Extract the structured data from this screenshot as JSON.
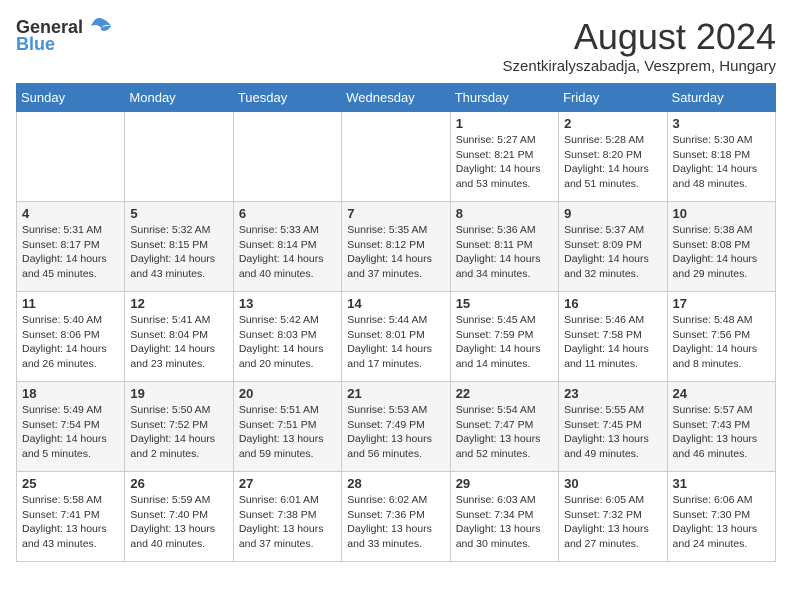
{
  "header": {
    "logo_general": "General",
    "logo_blue": "Blue",
    "month_year": "August 2024",
    "location": "Szentkiralyszabadja, Veszprem, Hungary"
  },
  "days_of_week": [
    "Sunday",
    "Monday",
    "Tuesday",
    "Wednesday",
    "Thursday",
    "Friday",
    "Saturday"
  ],
  "weeks": [
    {
      "days": [
        {
          "number": "",
          "info": ""
        },
        {
          "number": "",
          "info": ""
        },
        {
          "number": "",
          "info": ""
        },
        {
          "number": "",
          "info": ""
        },
        {
          "number": "1",
          "info": "Sunrise: 5:27 AM\nSunset: 8:21 PM\nDaylight: 14 hours and 53 minutes."
        },
        {
          "number": "2",
          "info": "Sunrise: 5:28 AM\nSunset: 8:20 PM\nDaylight: 14 hours and 51 minutes."
        },
        {
          "number": "3",
          "info": "Sunrise: 5:30 AM\nSunset: 8:18 PM\nDaylight: 14 hours and 48 minutes."
        }
      ]
    },
    {
      "days": [
        {
          "number": "4",
          "info": "Sunrise: 5:31 AM\nSunset: 8:17 PM\nDaylight: 14 hours and 45 minutes."
        },
        {
          "number": "5",
          "info": "Sunrise: 5:32 AM\nSunset: 8:15 PM\nDaylight: 14 hours and 43 minutes."
        },
        {
          "number": "6",
          "info": "Sunrise: 5:33 AM\nSunset: 8:14 PM\nDaylight: 14 hours and 40 minutes."
        },
        {
          "number": "7",
          "info": "Sunrise: 5:35 AM\nSunset: 8:12 PM\nDaylight: 14 hours and 37 minutes."
        },
        {
          "number": "8",
          "info": "Sunrise: 5:36 AM\nSunset: 8:11 PM\nDaylight: 14 hours and 34 minutes."
        },
        {
          "number": "9",
          "info": "Sunrise: 5:37 AM\nSunset: 8:09 PM\nDaylight: 14 hours and 32 minutes."
        },
        {
          "number": "10",
          "info": "Sunrise: 5:38 AM\nSunset: 8:08 PM\nDaylight: 14 hours and 29 minutes."
        }
      ]
    },
    {
      "days": [
        {
          "number": "11",
          "info": "Sunrise: 5:40 AM\nSunset: 8:06 PM\nDaylight: 14 hours and 26 minutes."
        },
        {
          "number": "12",
          "info": "Sunrise: 5:41 AM\nSunset: 8:04 PM\nDaylight: 14 hours and 23 minutes."
        },
        {
          "number": "13",
          "info": "Sunrise: 5:42 AM\nSunset: 8:03 PM\nDaylight: 14 hours and 20 minutes."
        },
        {
          "number": "14",
          "info": "Sunrise: 5:44 AM\nSunset: 8:01 PM\nDaylight: 14 hours and 17 minutes."
        },
        {
          "number": "15",
          "info": "Sunrise: 5:45 AM\nSunset: 7:59 PM\nDaylight: 14 hours and 14 minutes."
        },
        {
          "number": "16",
          "info": "Sunrise: 5:46 AM\nSunset: 7:58 PM\nDaylight: 14 hours and 11 minutes."
        },
        {
          "number": "17",
          "info": "Sunrise: 5:48 AM\nSunset: 7:56 PM\nDaylight: 14 hours and 8 minutes."
        }
      ]
    },
    {
      "days": [
        {
          "number": "18",
          "info": "Sunrise: 5:49 AM\nSunset: 7:54 PM\nDaylight: 14 hours and 5 minutes."
        },
        {
          "number": "19",
          "info": "Sunrise: 5:50 AM\nSunset: 7:52 PM\nDaylight: 14 hours and 2 minutes."
        },
        {
          "number": "20",
          "info": "Sunrise: 5:51 AM\nSunset: 7:51 PM\nDaylight: 13 hours and 59 minutes."
        },
        {
          "number": "21",
          "info": "Sunrise: 5:53 AM\nSunset: 7:49 PM\nDaylight: 13 hours and 56 minutes."
        },
        {
          "number": "22",
          "info": "Sunrise: 5:54 AM\nSunset: 7:47 PM\nDaylight: 13 hours and 52 minutes."
        },
        {
          "number": "23",
          "info": "Sunrise: 5:55 AM\nSunset: 7:45 PM\nDaylight: 13 hours and 49 minutes."
        },
        {
          "number": "24",
          "info": "Sunrise: 5:57 AM\nSunset: 7:43 PM\nDaylight: 13 hours and 46 minutes."
        }
      ]
    },
    {
      "days": [
        {
          "number": "25",
          "info": "Sunrise: 5:58 AM\nSunset: 7:41 PM\nDaylight: 13 hours and 43 minutes."
        },
        {
          "number": "26",
          "info": "Sunrise: 5:59 AM\nSunset: 7:40 PM\nDaylight: 13 hours and 40 minutes."
        },
        {
          "number": "27",
          "info": "Sunrise: 6:01 AM\nSunset: 7:38 PM\nDaylight: 13 hours and 37 minutes."
        },
        {
          "number": "28",
          "info": "Sunrise: 6:02 AM\nSunset: 7:36 PM\nDaylight: 13 hours and 33 minutes."
        },
        {
          "number": "29",
          "info": "Sunrise: 6:03 AM\nSunset: 7:34 PM\nDaylight: 13 hours and 30 minutes."
        },
        {
          "number": "30",
          "info": "Sunrise: 6:05 AM\nSunset: 7:32 PM\nDaylight: 13 hours and 27 minutes."
        },
        {
          "number": "31",
          "info": "Sunrise: 6:06 AM\nSunset: 7:30 PM\nDaylight: 13 hours and 24 minutes."
        }
      ]
    }
  ]
}
